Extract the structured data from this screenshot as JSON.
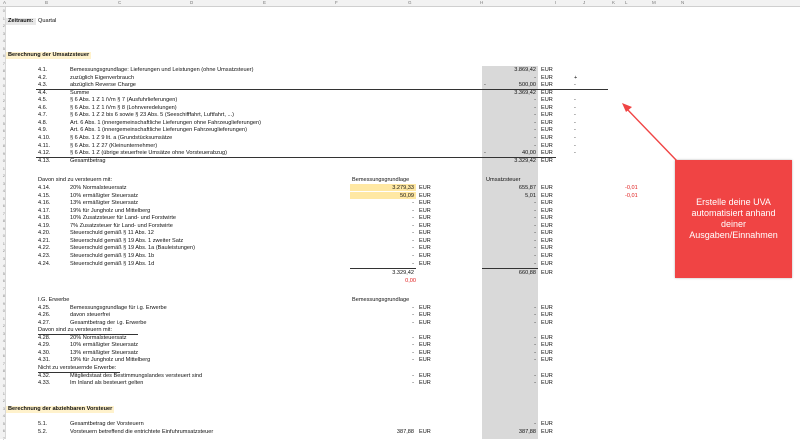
{
  "sheet": {
    "columns": [
      "A",
      "B",
      "C",
      "D",
      "E",
      "F",
      "G",
      "H",
      "I",
      "J",
      "K",
      "L",
      "M",
      "N"
    ],
    "zeitraum_label": "Zeitraum:",
    "zeitraum_value": "Quartal",
    "section1_title": "Berechnung der Umsatzsteuer",
    "section2_title": "Berechnung der abziehbaren Vorsteuer",
    "rows_top": [
      {
        "no": "4.1.",
        "label": "Bemessungsgrundlage: Lieferungen und Leistungen (ohne Umsatzsteuer)",
        "sign": "",
        "value": "3.869,42",
        "unit": "EUR",
        "extra": ""
      },
      {
        "no": "4.2.",
        "label": "zuzüglich Eigenverbrauch",
        "sign": "",
        "value": "-",
        "unit": "EUR",
        "extra": "+"
      },
      {
        "no": "4.3.",
        "label": "abzüglich Reverse Charge",
        "sign": "-",
        "value": "500,00",
        "unit": "EUR",
        "extra": "-"
      },
      {
        "no": "4.4.",
        "label": "Summe",
        "sign": "",
        "value": "3.369,42",
        "unit": "EUR",
        "extra": ""
      },
      {
        "no": "4.5.",
        "label": "§ 6 Abs. 1 Z 1 iVm § 7 (Ausfuhrlieferungen)",
        "sign": "",
        "value": "-",
        "unit": "EUR",
        "extra": "-"
      },
      {
        "no": "4.6.",
        "label": "§ 6 Abs. 1 Z 1 iVm § 8 (Lohnveredelungen)",
        "sign": "",
        "value": "-",
        "unit": "EUR",
        "extra": "-"
      },
      {
        "no": "4.7.",
        "label": "§ 6 Abs. 1 Z 2 bis 6 sowie § 23 Abs. 5 (Seeschifffahrt, Luftfahrt, ...)",
        "sign": "",
        "value": "-",
        "unit": "EUR",
        "extra": "-"
      },
      {
        "no": "4.8.",
        "label": "Art. 6 Abs. 1 (innergemeinschaftliche Lieferungen ohne Fahrzeuglieferungen)",
        "sign": "",
        "value": "-",
        "unit": "EUR",
        "extra": "-"
      },
      {
        "no": "4.9.",
        "label": "Art. 6 Abs. 1 (innergemeinschaftliche Lieferungen Fahrzeuglieferungen)",
        "sign": "",
        "value": "-",
        "unit": "EUR",
        "extra": "-"
      },
      {
        "no": "4.10.",
        "label": "§ 6 Abs. 1 Z 9 lit. a (Grundstücksumsätze",
        "sign": "",
        "value": "-",
        "unit": "EUR",
        "extra": "-"
      },
      {
        "no": "4.11.",
        "label": "§ 6 Abs. 1 Z 27 (Kleinunternehmer)",
        "sign": "",
        "value": "-",
        "unit": "EUR",
        "extra": "-"
      },
      {
        "no": "4.12.",
        "label": "§ 6 Abs. 1 Z (übrige steuerfreie Umsätze ohne Vorsteuerabzug)",
        "sign": "-",
        "value": "40,00",
        "unit": "EUR",
        "extra": "-"
      },
      {
        "no": "4.13.",
        "label": "Gesamtbetrag",
        "sign": "",
        "value": "3.329,42",
        "unit": "EUR",
        "extra": ""
      }
    ],
    "davon_label": "Davon sind zu versteuern mit:",
    "bemessung_header": "Bemessungsgrundlage",
    "umsatzsteuer_header": "Umsatzsteuer",
    "rows_mid": [
      {
        "no": "4.14.",
        "label": "20% Normalsteuersatz",
        "base": "3.279,33",
        "bunit": "EUR",
        "tax": "655,87",
        "tunit": "EUR",
        "diff": "-0,01"
      },
      {
        "no": "4.15.",
        "label": "10% ermäßigter Steuersatz",
        "base": "50,09",
        "bunit": "EUR",
        "tax": "5,01",
        "tunit": "EUR",
        "diff": "-0,01"
      },
      {
        "no": "4.16.",
        "label": "13% ermäßigter Steuersatz",
        "base": "-",
        "bunit": "EUR",
        "tax": "-",
        "tunit": "EUR",
        "diff": ""
      },
      {
        "no": "4.17.",
        "label": "19% für Jungholz und Mittelberg",
        "base": "-",
        "bunit": "EUR",
        "tax": "-",
        "tunit": "EUR",
        "diff": ""
      },
      {
        "no": "4.18.",
        "label": "10% Zusatzsteuer für Land- und Forstwirte",
        "base": "-",
        "bunit": "EUR",
        "tax": "-",
        "tunit": "EUR",
        "diff": ""
      },
      {
        "no": "4.19.",
        "label": "7% Zusatzsteuer für Land- und Forstwirte",
        "base": "-",
        "bunit": "EUR",
        "tax": "-",
        "tunit": "EUR",
        "diff": ""
      },
      {
        "no": "4.20.",
        "label": "Steuerschuld gemäß § 11 Abs. 12",
        "base": "-",
        "bunit": "EUR",
        "tax": "-",
        "tunit": "EUR",
        "diff": ""
      },
      {
        "no": "4.21.",
        "label": "Steuerschuld gemäß § 19 Abs. 1 zweiter Satz",
        "base": "-",
        "bunit": "EUR",
        "tax": "-",
        "tunit": "EUR",
        "diff": ""
      },
      {
        "no": "4.22.",
        "label": "Steuerschuld gemäß § 19 Abs. 1a (Bauleistungen)",
        "base": "-",
        "bunit": "EUR",
        "tax": "-",
        "tunit": "EUR",
        "diff": ""
      },
      {
        "no": "4.23.",
        "label": "Steuerschuld gemäß § 19 Abs. 1b",
        "base": "-",
        "bunit": "EUR",
        "tax": "-",
        "tunit": "EUR",
        "diff": ""
      },
      {
        "no": "4.24.",
        "label": "Steuerschuld gemäß § 19 Abs. 1d",
        "base": "-",
        "bunit": "EUR",
        "tax": "-",
        "tunit": "EUR",
        "diff": ""
      }
    ],
    "sum_base": "3.329,42",
    "sum_tax": "660,88",
    "sum_unit": "EUR",
    "sum_diff": "0,00",
    "ig_label": "I.G. Erwerbe",
    "ig_bemessung_header": "Bemessungsgrundlage",
    "rows_ig": [
      {
        "no": "4.25.",
        "label": "Bemessungsgrundlage für i.g. Erwerbe",
        "base": "-",
        "bunit": "EUR",
        "tax": "-",
        "tunit": "EUR"
      },
      {
        "no": "4.26.",
        "label": "davon steuerfrei",
        "base": "-",
        "bunit": "EUR",
        "tax": "-",
        "tunit": "EUR"
      },
      {
        "no": "4.27.",
        "label": "Gesamtbetrag der i.g. Erwerbe",
        "base": "-",
        "bunit": "EUR",
        "tax": "-",
        "tunit": "EUR"
      }
    ],
    "ig_davon_label": "Davon sind zu versteuern mit:",
    "rows_ig2": [
      {
        "no": "4.28.",
        "label": "20% Normalsteuersatz",
        "base": "-",
        "bunit": "EUR",
        "tax": "-",
        "tunit": "EUR"
      },
      {
        "no": "4.29.",
        "label": "10% ermäßigter Steuersatz",
        "base": "-",
        "bunit": "EUR",
        "tax": "-",
        "tunit": "EUR"
      },
      {
        "no": "4.30.",
        "label": "13% ermäßigter Steuersatz",
        "base": "-",
        "bunit": "EUR",
        "tax": "-",
        "tunit": "EUR"
      },
      {
        "no": "4.31.",
        "label": "19% für Jungholz und Mittelberg",
        "base": "-",
        "bunit": "EUR",
        "tax": "-",
        "tunit": "EUR"
      }
    ],
    "nicht_label": "Nicht zu versteuernde Erwerbe:",
    "rows_ig3": [
      {
        "no": "4.32.",
        "label": "Mitgliedstaat des Bestimmungslandes versteuert sind",
        "base": "-",
        "bunit": "EUR",
        "tax": "-",
        "tunit": "EUR"
      },
      {
        "no": "4.33.",
        "label": "Im Inland als besteuert gelten",
        "base": "-",
        "bunit": "EUR",
        "tax": "-",
        "tunit": "EUR"
      }
    ],
    "rows_vst": [
      {
        "no": "5.1.",
        "label": "Gesamtbetrag der Vorsteuern",
        "base": "",
        "bunit": "",
        "tax": "-",
        "tunit": "EUR"
      },
      {
        "no": "5.2.",
        "label": "Vorsteuern betreffend die entrichtete Einfuhrumsatzsteuer",
        "base": "387,88",
        "bunit": "EUR",
        "tax": "387,88",
        "tunit": "EUR"
      }
    ]
  },
  "callout": {
    "text": "Erstelle deine UVA automatisiert anhand deiner Ausgaben/Einnahmen",
    "color": "#f04444"
  }
}
